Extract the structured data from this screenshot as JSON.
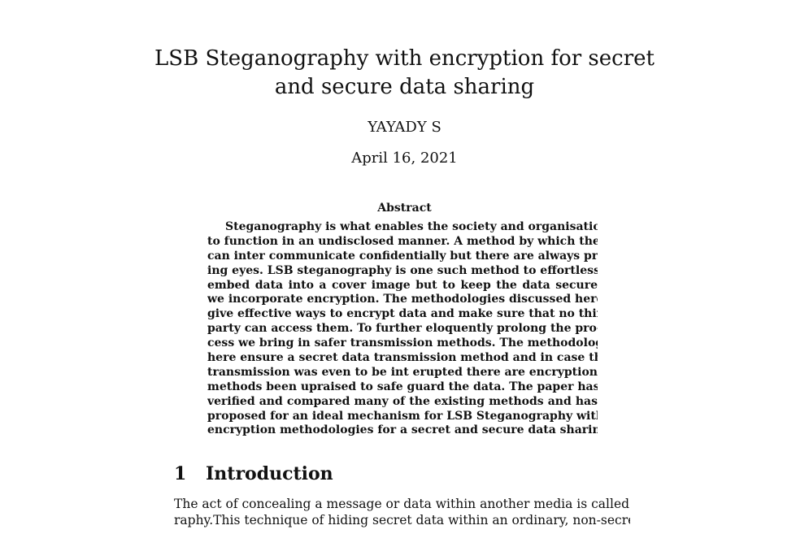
{
  "paper": {
    "title_lines": [
      "LSB Steganography with encryption for secret",
      "and secure data sharing"
    ],
    "author": "YAYADY S",
    "date": "April 16, 2021",
    "abstract": {
      "heading": "Abstract",
      "lines": [
        "Steganography is what enables the society and organisations",
        "to function in an undisclosed manner. A method by which they",
        "can inter communicate confidentially but there are always pry-",
        "ing eyes. LSB steganography is one such method to effortlessly",
        "embed data into a cover image but to keep the data secure",
        "we incorporate encryption. The methodologies discussed here",
        "give effective ways to encrypt data and make sure that no third",
        "party can access them. To further eloquently prolong the pro-",
        "cess we bring in safer transmission methods. The methodologies",
        "here ensure a secret data transmission method and in case the",
        "transmission was even to be int erupted there are encryptions",
        "methods been upraised to safe guard the data. The paper has",
        "verified and compared many of the existing methods and has",
        "proposed for an ideal mechanism for LSB Steganography with",
        "encryption methodologies for a secret and secure data sharing."
      ]
    },
    "section": {
      "number": "1",
      "title": "Introduction",
      "lines": [
        "The act of concealing a message or data within another media is called Steganog-",
        "raphy.This technique of hiding secret data within an ordinary, non-secret, file or"
      ]
    }
  }
}
